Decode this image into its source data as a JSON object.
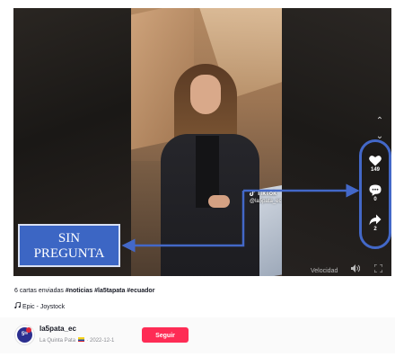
{
  "video": {
    "watermark_brand": "TikTok",
    "watermark_user": "@la5pata_ec",
    "speed_label": "Velocidad",
    "more_label": "···"
  },
  "annotation": {
    "line1": "SIN",
    "line2": "PREGUNTA",
    "color": "#3c66c4"
  },
  "actions": {
    "likes": "149",
    "comments": "0",
    "shares": "2"
  },
  "caption": {
    "text": "6 cartas enviadas ",
    "hashtags": "#noticias #la5tapata #ecuador"
  },
  "music": {
    "label": "Epic - Joystock"
  },
  "author": {
    "username": "la5pata_ec",
    "display_name": "La Quinta Pata",
    "date": "· 2022-12-1",
    "avatar_text": "5ᵗᵃ",
    "follow_label": "Seguir",
    "follow_color": "#fe2c55"
  }
}
